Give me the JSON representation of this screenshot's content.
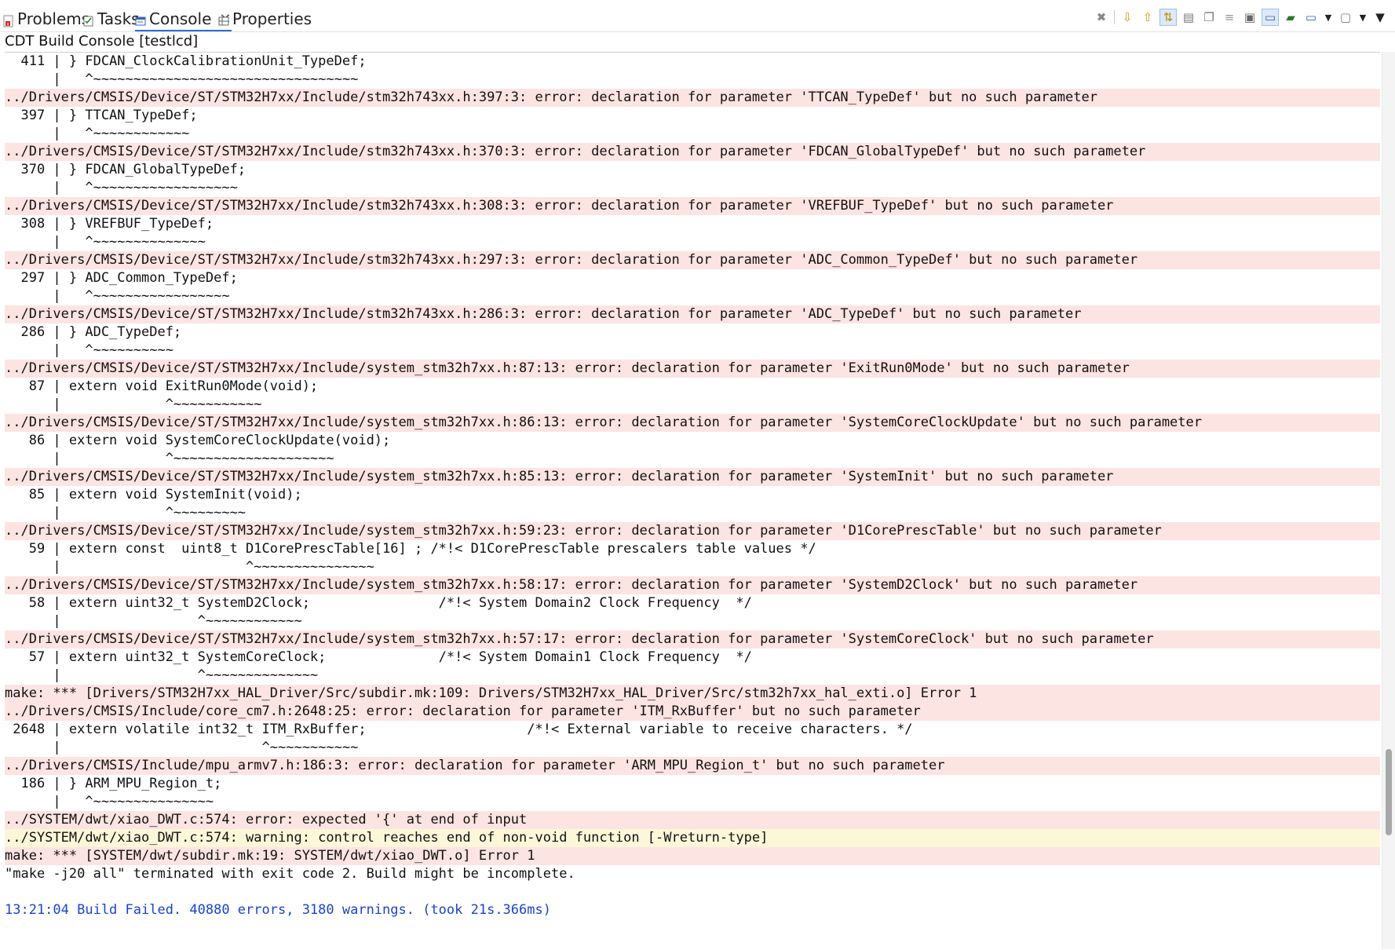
{
  "tabs": [
    {
      "label": "Problems",
      "icon": "problems-icon",
      "active": false
    },
    {
      "label": "Tasks",
      "icon": "tasks-icon",
      "active": false
    },
    {
      "label": "Console",
      "icon": "console-icon",
      "active": true,
      "close": "✕"
    },
    {
      "label": "Properties",
      "icon": "properties-icon",
      "active": false
    }
  ],
  "toolbar": [
    "terminate-icon",
    "scroll-down-icon",
    "scroll-up-icon",
    "scroll-lock-icon",
    "clear-console-icon",
    "copy-icon",
    "word-wrap-icon",
    "open-file-icon",
    "show-console-icon",
    "pin-console-icon",
    "display-console-icon",
    "new-console-icon",
    "view-menu-icon"
  ],
  "console": {
    "title": "CDT Build Console [testlcd]",
    "scroll_position": 0.86,
    "colors": {
      "error_bg": "#fce4e2",
      "warning_bg": "#fdf7d9",
      "info_text": "#1a44c8"
    },
    "lines": [
      {
        "type": "normal",
        "text": "  411 | } FDCAN_ClockCalibrationUnit_TypeDef;"
      },
      {
        "type": "normal",
        "text": "      |   ^~~~~~~~~~~~~~~~~~~~~~~~~~~~~~~~~~"
      },
      {
        "type": "error",
        "text": "../Drivers/CMSIS/Device/ST/STM32H7xx/Include/stm32h743xx.h:397:3: error: declaration for parameter 'TTCAN_TypeDef' but no such parameter"
      },
      {
        "type": "normal",
        "text": "  397 | } TTCAN_TypeDef;"
      },
      {
        "type": "normal",
        "text": "      |   ^~~~~~~~~~~~~"
      },
      {
        "type": "error",
        "text": "../Drivers/CMSIS/Device/ST/STM32H7xx/Include/stm32h743xx.h:370:3: error: declaration for parameter 'FDCAN_GlobalTypeDef' but no such parameter"
      },
      {
        "type": "normal",
        "text": "  370 | } FDCAN_GlobalTypeDef;"
      },
      {
        "type": "normal",
        "text": "      |   ^~~~~~~~~~~~~~~~~~~"
      },
      {
        "type": "error",
        "text": "../Drivers/CMSIS/Device/ST/STM32H7xx/Include/stm32h743xx.h:308:3: error: declaration for parameter 'VREFBUF_TypeDef' but no such parameter"
      },
      {
        "type": "normal",
        "text": "  308 | } VREFBUF_TypeDef;"
      },
      {
        "type": "normal",
        "text": "      |   ^~~~~~~~~~~~~~~"
      },
      {
        "type": "error",
        "text": "../Drivers/CMSIS/Device/ST/STM32H7xx/Include/stm32h743xx.h:297:3: error: declaration for parameter 'ADC_Common_TypeDef' but no such parameter"
      },
      {
        "type": "normal",
        "text": "  297 | } ADC_Common_TypeDef;"
      },
      {
        "type": "normal",
        "text": "      |   ^~~~~~~~~~~~~~~~~~"
      },
      {
        "type": "error",
        "text": "../Drivers/CMSIS/Device/ST/STM32H7xx/Include/stm32h743xx.h:286:3: error: declaration for parameter 'ADC_TypeDef' but no such parameter"
      },
      {
        "type": "normal",
        "text": "  286 | } ADC_TypeDef;"
      },
      {
        "type": "normal",
        "text": "      |   ^~~~~~~~~~~"
      },
      {
        "type": "error",
        "text": "../Drivers/CMSIS/Device/ST/STM32H7xx/Include/system_stm32h7xx.h:87:13: error: declaration for parameter 'ExitRun0Mode' but no such parameter"
      },
      {
        "type": "normal",
        "text": "   87 | extern void ExitRun0Mode(void);"
      },
      {
        "type": "normal",
        "text": "      |             ^~~~~~~~~~~~"
      },
      {
        "type": "error",
        "text": "../Drivers/CMSIS/Device/ST/STM32H7xx/Include/system_stm32h7xx.h:86:13: error: declaration for parameter 'SystemCoreClockUpdate' but no such parameter"
      },
      {
        "type": "normal",
        "text": "   86 | extern void SystemCoreClockUpdate(void);"
      },
      {
        "type": "normal",
        "text": "      |             ^~~~~~~~~~~~~~~~~~~~~"
      },
      {
        "type": "error",
        "text": "../Drivers/CMSIS/Device/ST/STM32H7xx/Include/system_stm32h7xx.h:85:13: error: declaration for parameter 'SystemInit' but no such parameter"
      },
      {
        "type": "normal",
        "text": "   85 | extern void SystemInit(void);"
      },
      {
        "type": "normal",
        "text": "      |             ^~~~~~~~~~"
      },
      {
        "type": "error",
        "text": "../Drivers/CMSIS/Device/ST/STM32H7xx/Include/system_stm32h7xx.h:59:23: error: declaration for parameter 'D1CorePrescTable' but no such parameter"
      },
      {
        "type": "normal",
        "text": "   59 | extern const  uint8_t D1CorePrescTable[16] ; /*!< D1CorePrescTable prescalers table values */"
      },
      {
        "type": "normal",
        "text": "      |                       ^~~~~~~~~~~~~~~~"
      },
      {
        "type": "error",
        "text": "../Drivers/CMSIS/Device/ST/STM32H7xx/Include/system_stm32h7xx.h:58:17: error: declaration for parameter 'SystemD2Clock' but no such parameter"
      },
      {
        "type": "normal",
        "text": "   58 | extern uint32_t SystemD2Clock;                /*!< System Domain2 Clock Frequency  */"
      },
      {
        "type": "normal",
        "text": "      |                 ^~~~~~~~~~~~~"
      },
      {
        "type": "error",
        "text": "../Drivers/CMSIS/Device/ST/STM32H7xx/Include/system_stm32h7xx.h:57:17: error: declaration for parameter 'SystemCoreClock' but no such parameter"
      },
      {
        "type": "normal",
        "text": "   57 | extern uint32_t SystemCoreClock;              /*!< System Domain1 Clock Frequency  */"
      },
      {
        "type": "normal",
        "text": "      |                 ^~~~~~~~~~~~~~~"
      },
      {
        "type": "error",
        "text": "make: *** [Drivers/STM32H7xx_HAL_Driver/Src/subdir.mk:109: Drivers/STM32H7xx_HAL_Driver/Src/stm32h7xx_hal_exti.o] Error 1"
      },
      {
        "type": "error",
        "text": "../Drivers/CMSIS/Include/core_cm7.h:2648:25: error: declaration for parameter 'ITM_RxBuffer' but no such parameter"
      },
      {
        "type": "normal",
        "text": " 2648 | extern volatile int32_t ITM_RxBuffer;                    /*!< External variable to receive characters. */"
      },
      {
        "type": "normal",
        "text": "      |                         ^~~~~~~~~~~~"
      },
      {
        "type": "error",
        "text": "../Drivers/CMSIS/Include/mpu_armv7.h:186:3: error: declaration for parameter 'ARM_MPU_Region_t' but no such parameter"
      },
      {
        "type": "normal",
        "text": "  186 | } ARM_MPU_Region_t;"
      },
      {
        "type": "normal",
        "text": "      |   ^~~~~~~~~~~~~~~~"
      },
      {
        "type": "error",
        "text": "../SYSTEM/dwt/xiao_DWT.c:574: error: expected '{' at end of input"
      },
      {
        "type": "warning",
        "text": "../SYSTEM/dwt/xiao_DWT.c:574: warning: control reaches end of non-void function [-Wreturn-type]"
      },
      {
        "type": "error",
        "text": "make: *** [SYSTEM/dwt/subdir.mk:19: SYSTEM/dwt/xiao_DWT.o] Error 1"
      },
      {
        "type": "normal",
        "text": "\"make -j20 all\" terminated with exit code 2. Build might be incomplete."
      },
      {
        "type": "normal",
        "text": ""
      },
      {
        "type": "info",
        "text": "13:21:04 Build Failed. 40880 errors, 3180 warnings. (took 21s.366ms)"
      }
    ]
  }
}
